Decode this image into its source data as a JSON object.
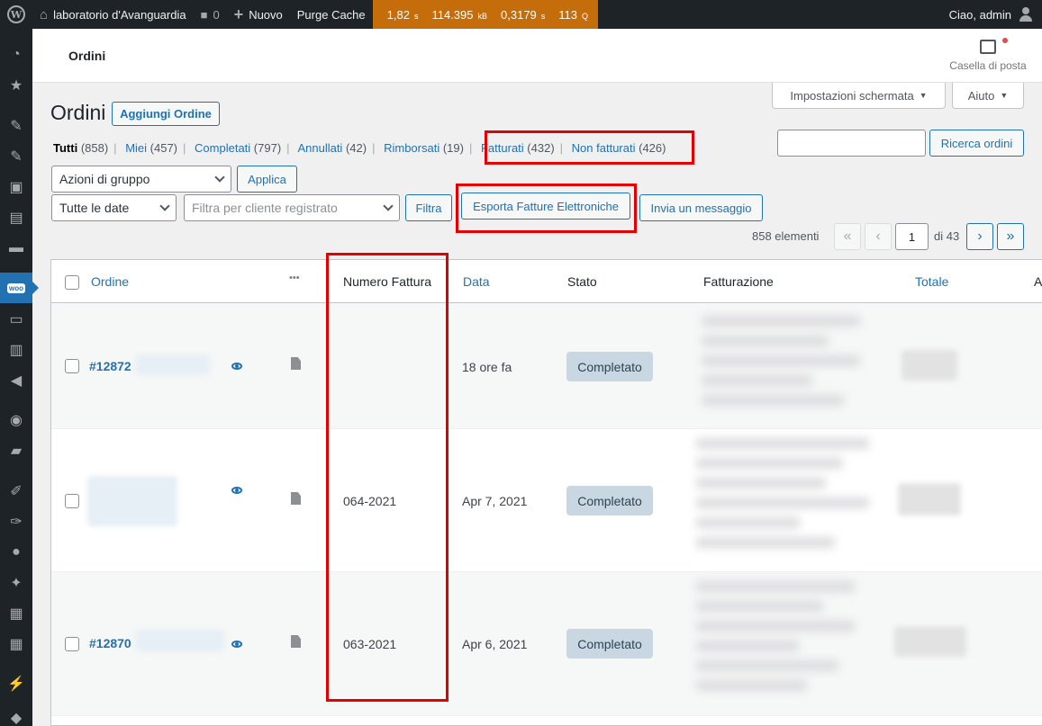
{
  "admin_bar": {
    "site_name": "laboratorio d'Avanguardia",
    "comments_count": "0",
    "new_label": "Nuovo",
    "purge_label": "Purge Cache",
    "qm": {
      "time": "1,82",
      "time_unit": "s",
      "memory": "114.395",
      "memory_unit": "kB",
      "db_time": "0,3179",
      "db_unit": "s",
      "queries": "113",
      "queries_unit": "Q"
    },
    "greeting": "Ciao, admin"
  },
  "woo_header": {
    "title": "Ordini",
    "inbox_label": "Casella di posta"
  },
  "screen_options": {
    "options_label": "Impostazioni schermata",
    "help_label": "Aiuto"
  },
  "page": {
    "title": "Ordini",
    "add_button": "Aggiungi Ordine"
  },
  "views": [
    {
      "label": "Tutti",
      "count": "(858)",
      "current": true
    },
    {
      "label": "Miei",
      "count": "(457)"
    },
    {
      "label": "Completati",
      "count": "(797)"
    },
    {
      "label": "Annullati",
      "count": "(42)"
    },
    {
      "label": "Rimborsati",
      "count": "(19)"
    },
    {
      "label": "Fatturati",
      "count": "(432)"
    },
    {
      "label": "Non fatturati",
      "count": "(426)"
    }
  ],
  "search": {
    "button": "Ricerca ordini",
    "value": ""
  },
  "bulk": {
    "action_selected": "Azioni di gruppo",
    "apply": "Applica"
  },
  "filters": {
    "date_selected": "Tutte le date",
    "customer_placeholder": "Filtra per cliente registrato",
    "filter_button": "Filtra",
    "export_button": "Esporta Fatture Elettroniche",
    "message_button": "Invia un messaggio"
  },
  "pagination": {
    "items": "858 elementi",
    "first": "«",
    "prev": "‹",
    "current": "1",
    "of": "di 43",
    "next": "›",
    "last": "»"
  },
  "table": {
    "columns": {
      "order": "Ordine",
      "more": "•••",
      "invoice_number": "Numero Fattura",
      "date": "Data",
      "status": "Stato",
      "billing": "Fatturazione",
      "total": "Totale",
      "actions": "A"
    },
    "rows": [
      {
        "order": "#12872",
        "invoice": "",
        "date": "18 ore fa",
        "status": "Completato"
      },
      {
        "order": "",
        "invoice": "064-2021",
        "date": "Apr 7, 2021",
        "status": "Completato"
      },
      {
        "order": "#12870",
        "invoice": "063-2021",
        "date": "Apr 6, 2021",
        "status": "Completato"
      }
    ]
  },
  "colors": {
    "admin_bar": "#1d2327",
    "link": "#2271b1",
    "highlight_box": "#e30000",
    "status_completed": "#c8d7e1",
    "qm_badge": "#c56d0a"
  }
}
